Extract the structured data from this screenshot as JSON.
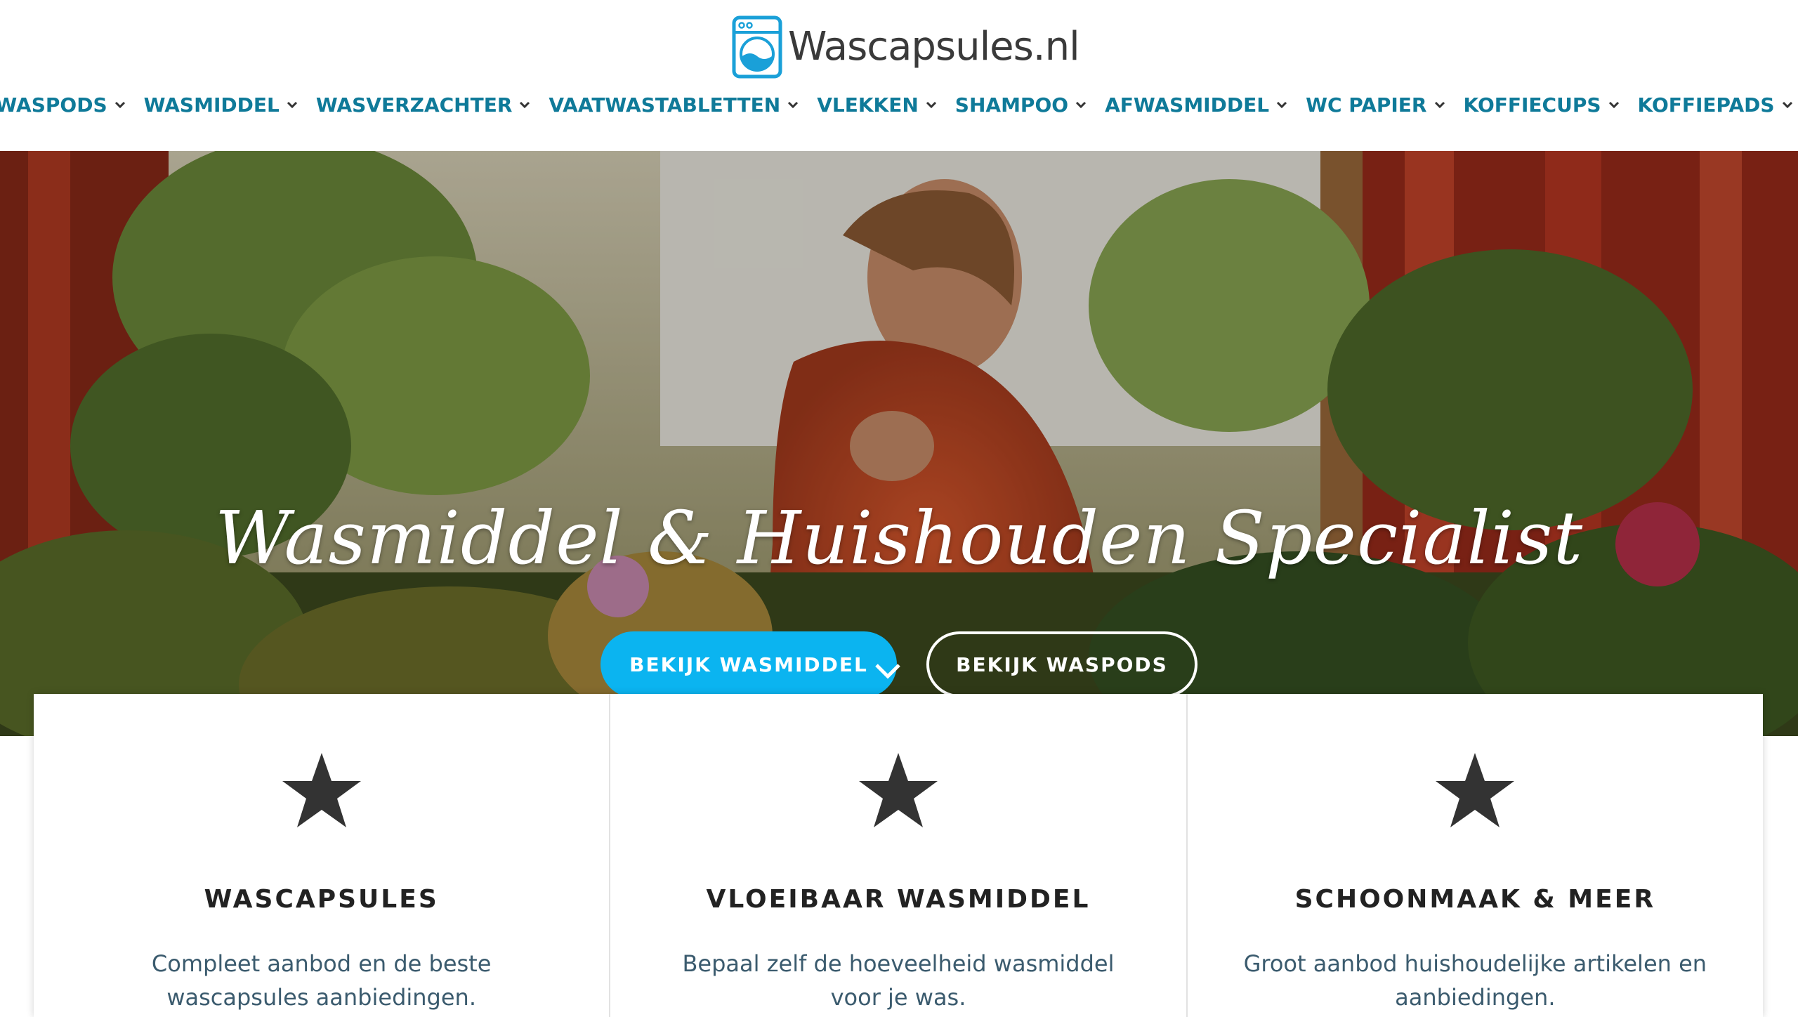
{
  "brand": {
    "name": "Wascapsules.nl",
    "logo_icon": "washing-machine-icon",
    "color": "#1aa0d8"
  },
  "nav": {
    "items": [
      {
        "label": "WASPODS"
      },
      {
        "label": "WASMIDDEL"
      },
      {
        "label": "WASVERZACHTER"
      },
      {
        "label": "VAATWASTABLETTEN"
      },
      {
        "label": "VLEKKEN"
      },
      {
        "label": "SHAMPOO"
      },
      {
        "label": "AFWASMIDDEL"
      },
      {
        "label": "WC PAPIER"
      },
      {
        "label": "KOFFIECUPS"
      },
      {
        "label": "KOFFIEPADS"
      }
    ],
    "color": "#0f7a99",
    "chevron_icon": "chevron-down-icon"
  },
  "hero": {
    "title": "Wasmiddel & Huishouden Specialist",
    "primary_button": "BEKIJK WASMIDDEL",
    "secondary_button": "BEKIJK WASPODS",
    "primary_color": "#0bb4f0",
    "scroll_icon": "chevron-down-icon"
  },
  "features": [
    {
      "icon": "star-icon",
      "title": "WASCAPSULES",
      "text": "Compleet aanbod en de beste wascapsules aanbiedingen."
    },
    {
      "icon": "star-icon",
      "title": "VLOEIBAAR WASMIDDEL",
      "text": "Bepaal zelf de hoeveelheid wasmiddel voor je was."
    },
    {
      "icon": "star-icon",
      "title": "SCHOONMAAK & MEER",
      "text": "Groot aanbod huishoudelijke artikelen en aanbiedingen."
    }
  ]
}
